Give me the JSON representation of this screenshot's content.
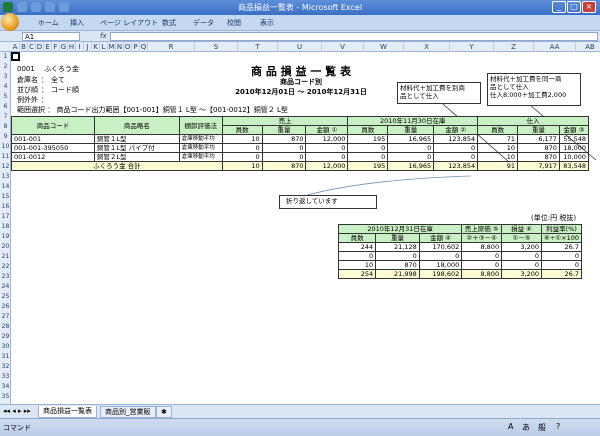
{
  "window": {
    "title": "商品損益一覧表 - Microsoft Excel"
  },
  "ribbon": {
    "tabs": [
      "ホーム",
      "挿入",
      "ページ レイアウト",
      "数式",
      "データ",
      "校閲",
      "表示"
    ]
  },
  "formula_bar": {
    "name_box": "A1",
    "fx": "fx",
    "value": ""
  },
  "columns": [
    "A",
    "B",
    "C",
    "D",
    "E",
    "F",
    "G",
    "H",
    "I",
    "J",
    "K",
    "L",
    "M",
    "N",
    "O",
    "P",
    "Q",
    "R",
    "S",
    "T",
    "U",
    "V",
    "W",
    "X",
    "Y",
    "Z",
    "AA",
    "AB"
  ],
  "rows": [
    "1",
    "2",
    "3",
    "4",
    "5",
    "6",
    "7",
    "8",
    "9",
    "10",
    "11",
    "12",
    "13",
    "14",
    "15",
    "16",
    "17",
    "18",
    "19",
    "20",
    "21",
    "22",
    "23",
    "24",
    "25",
    "26",
    "27",
    "28",
    "29",
    "30",
    "31",
    "32",
    "33",
    "34",
    "35"
  ],
  "header_info": {
    "code": "0001",
    "company": "ふくろう金",
    "dept_label": "倉庫名",
    "dept_sep": "：",
    "dept_value": "全て",
    "sort_label": "並び順",
    "sort_sep": "：",
    "sort_value": "コード順",
    "exclude_label": "例外外",
    "exclude_sep": "：",
    "range_text": "範囲選択 ： 商品コード出力範囲【001-001】銅管１ L型 ～【001-0012】銅管２ L型"
  },
  "report": {
    "title": "商 品 損 益 一 覧 表",
    "subtitle": "商品コード別",
    "period": "2010年12月01日 ～ 2010年12月31日"
  },
  "callouts": {
    "left": [
      "材料代＋加工費を別商",
      "品として仕入"
    ],
    "right": [
      "材料代＋加工費を同一商",
      "品として仕入",
      "仕入8,000＋加工費2,000"
    ],
    "wrap": "折り返しています"
  },
  "table1": {
    "headers": {
      "code": "商品コード",
      "name": "商品略名",
      "method": "棚卸評価法",
      "sales": "売上",
      "stock": "2010年11月30日在庫",
      "purchase": "仕入",
      "count": "員数",
      "qty": "重量",
      "amount1": "金額 ①",
      "amount2": "金額 ②",
      "amount3": "金額 ③"
    },
    "rows": [
      {
        "code": "001-001",
        "name": "銅管１L型",
        "method": "倉庫移動平均",
        "s_cnt": "10",
        "s_qty": "870",
        "s_amt": "12,000",
        "k_cnt": "195",
        "k_qty": "16,965",
        "k_amt": "123,854",
        "p_cnt": "71",
        "p_qty": "6,177",
        "p_amt": "55,548"
      },
      {
        "code": "001-001-395050",
        "name": "銅管１L型 パイプ付",
        "method": "倉庫移動平均",
        "s_cnt": "0",
        "s_qty": "0",
        "s_amt": "0",
        "k_cnt": "0",
        "k_qty": "0",
        "k_amt": "0",
        "p_cnt": "10",
        "p_qty": "870",
        "p_amt": "18,000"
      },
      {
        "code": "001-0012",
        "name": "銅管２L型",
        "method": "倉庫移動平均",
        "s_cnt": "0",
        "s_qty": "0",
        "s_amt": "0",
        "k_cnt": "0",
        "k_qty": "0",
        "k_amt": "0",
        "p_cnt": "10",
        "p_qty": "870",
        "p_amt": "10,000"
      }
    ],
    "total": {
      "label": "ふくろう金 合計",
      "s_cnt": "10",
      "s_qty": "870",
      "s_amt": "12,000",
      "k_cnt": "195",
      "k_qty": "16,965",
      "k_amt": "123,854",
      "p_cnt": "91",
      "p_qty": "7,917",
      "p_amt": "83,548"
    }
  },
  "table2": {
    "unit": "(単位:円 税抜)",
    "headers": {
      "stock": "2010年12月31日在庫",
      "cogs": "売上原価 ⑤",
      "cogs_formula": "②＋③－④",
      "profit": "損益 ⑥",
      "profit_formula": "①－⑤",
      "rate": "利益率(%)",
      "rate_formula": "⑥÷①×100",
      "count": "員数",
      "qty": "重量",
      "amount4": "金額 ④"
    },
    "rows": [
      {
        "cnt": "244",
        "qty": "21,128",
        "amt": "170,602",
        "cogs": "8,800",
        "profit": "3,200",
        "rate": "26.7"
      },
      {
        "cnt": "0",
        "qty": "0",
        "amt": "0",
        "cogs": "0",
        "profit": "0",
        "rate": "0"
      },
      {
        "cnt": "10",
        "qty": "870",
        "amt": "18,000",
        "cogs": "0",
        "profit": "0",
        "rate": "0"
      },
      {
        "cnt": "254",
        "qty": "21,998",
        "amt": "198,602",
        "cogs": "8,800",
        "profit": "3,200",
        "rate": "26.7"
      }
    ]
  },
  "sheet_tabs": [
    "商品損益一覧表",
    "商品別_営業販"
  ],
  "status": {
    "mode": "コマンド",
    "ime": [
      "A",
      "あ",
      "般"
    ]
  }
}
